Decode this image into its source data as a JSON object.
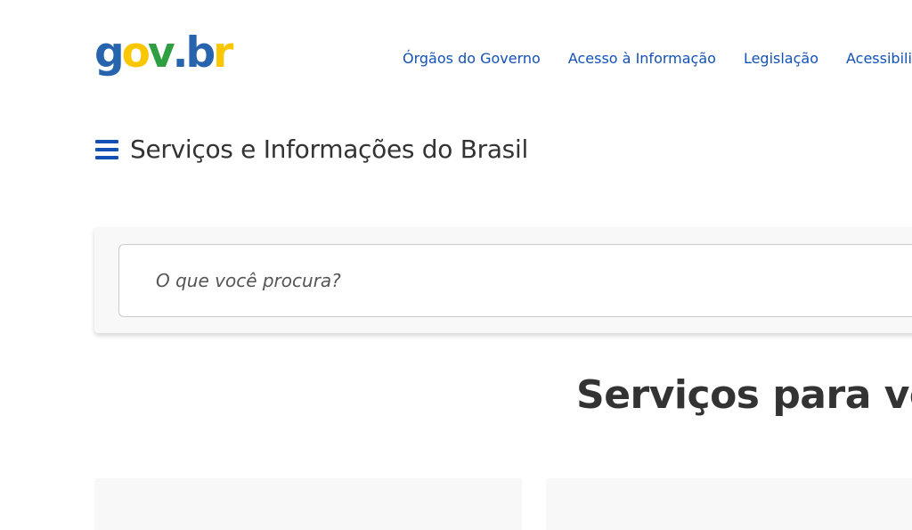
{
  "logo": {
    "letters": [
      {
        "char": "g",
        "color": "#2864ae"
      },
      {
        "char": "o",
        "color": "#f9c600"
      },
      {
        "char": "v",
        "color": "#2e9e41"
      },
      {
        "char": ".",
        "color": "#2864ae"
      },
      {
        "char": "b",
        "color": "#2864ae"
      },
      {
        "char": "r",
        "color": "#f9c600"
      }
    ]
  },
  "header": {
    "nav": [
      "Órgãos do Governo",
      "Acesso à Informação",
      "Legislação",
      "Acessibilidade"
    ]
  },
  "menu": {
    "icon": "hamburger-menu-icon",
    "title": "Serviços e Informações do Brasil"
  },
  "search": {
    "placeholder": "O que você procura?"
  },
  "main": {
    "heading": "Serviços para você"
  },
  "colors": {
    "link": "#1351b4",
    "text": "#333333",
    "card_bg": "#f8f8f8"
  }
}
